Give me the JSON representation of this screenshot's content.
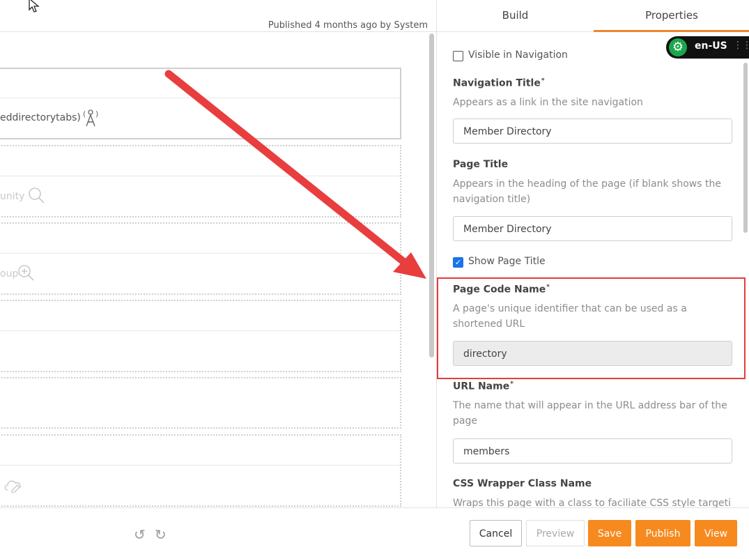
{
  "canvas": {
    "published_text": "Published 4 months ago by System",
    "fragments": {
      "tabs_widget": "eddirectorytabs)",
      "search_widget": "unity",
      "group_widget": "oup"
    }
  },
  "panel": {
    "tabs": [
      {
        "label": "Build"
      },
      {
        "label": "Properties",
        "active": true
      }
    ],
    "language": {
      "label": "en-US"
    },
    "visible_in_navigation": {
      "label": "Visible in Navigation",
      "checked": false
    },
    "navigation_title": {
      "label": "Navigation Title",
      "required_mark": "*",
      "help": "Appears as a link in the site navigation",
      "value": "Member Directory"
    },
    "page_title": {
      "label": "Page Title",
      "help": "Appears in the heading of the page (if blank shows the navigation title)",
      "value": "Member Directory"
    },
    "show_page_title": {
      "label": "Show Page Title",
      "checked": true
    },
    "page_code_name": {
      "label": "Page Code Name",
      "required_mark": "*",
      "help": "A page's unique identifier that can be used as a shortened URL",
      "value": "directory"
    },
    "url_name": {
      "label": "URL Name",
      "required_mark": "*",
      "help": "The name that will appear in the URL address bar of the page",
      "value": "members"
    },
    "css_wrapper": {
      "label": "CSS Wrapper Class Name",
      "help": "Wraps this page with a class to faciliate CSS style targeting"
    }
  },
  "footer": {
    "cancel": "Cancel",
    "preview": "Preview",
    "save": "Save",
    "publish": "Publish",
    "view": "View"
  },
  "colors": {
    "accent_orange": "#f68a1f",
    "tab_underline": "#f0852d",
    "highlight_red": "#e53b3b",
    "annotation_arrow": "#e83e3e",
    "language_gear_green": "#19a74a"
  }
}
